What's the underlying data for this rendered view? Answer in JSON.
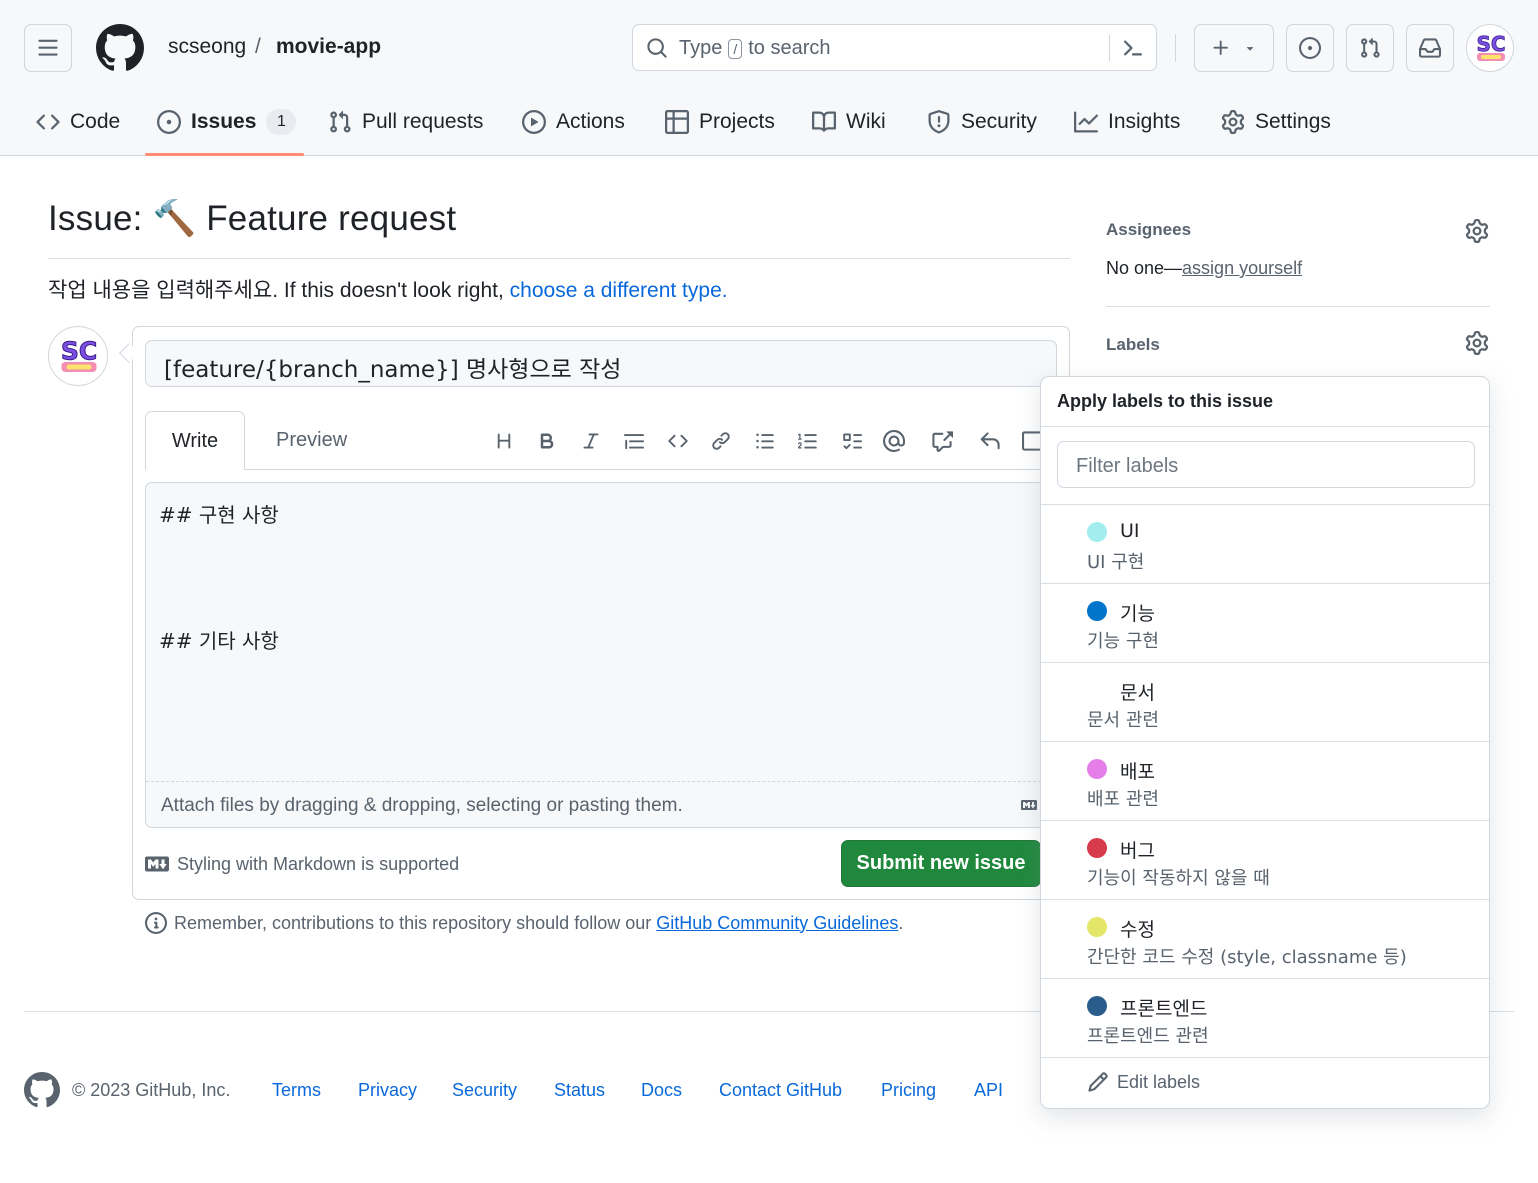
{
  "header": {
    "owner": "scseong",
    "separator": "/",
    "repo": "movie-app",
    "search": {
      "prefix": "Type",
      "key": "/",
      "suffix": "to search"
    },
    "avatar_text": "SC"
  },
  "tabs": [
    {
      "label": "Code",
      "icon": "code-icon"
    },
    {
      "label": "Issues",
      "icon": "issue-opened-icon",
      "counter": "1"
    },
    {
      "label": "Pull requests",
      "icon": "git-pull-request-icon"
    },
    {
      "label": "Actions",
      "icon": "play-icon"
    },
    {
      "label": "Projects",
      "icon": "table-icon"
    },
    {
      "label": "Wiki",
      "icon": "book-icon"
    },
    {
      "label": "Security",
      "icon": "shield-icon"
    },
    {
      "label": "Insights",
      "icon": "graph-icon"
    },
    {
      "label": "Settings",
      "icon": "gear-icon"
    }
  ],
  "page": {
    "title": "Issue: 🔨 Feature request",
    "subtitle_prefix": "작업 내용을 입력해주세요. If this doesn't look right, ",
    "subtitle_link": "choose a different type."
  },
  "form": {
    "title_value": "[feature/{branch_name}] 명사형으로 작성",
    "tab_write": "Write",
    "tab_preview": "Preview",
    "body_line_1": "## 구현 사항",
    "body_line_2": "## 기타 사항",
    "attach_text": "Attach files by dragging & dropping, selecting or pasting them.",
    "markdown_note": "Styling with Markdown is supported",
    "submit_label": "Submit new issue"
  },
  "remember": {
    "prefix": "Remember, contributions to this repository should follow our ",
    "link": "GitHub Community Guidelines",
    "suffix": "."
  },
  "sidebar": {
    "assignees_heading": "Assignees",
    "assignees_none": "No one—",
    "assign_yourself": "assign yourself",
    "labels_heading": "Labels"
  },
  "labels_dropdown": {
    "title": "Apply labels to this issue",
    "filter_placeholder": "Filter labels",
    "items": [
      {
        "name": "UI",
        "description": "UI 구현",
        "color": "#a2eeef"
      },
      {
        "name": "기능",
        "description": "기능 구현",
        "color": "#0075ca"
      },
      {
        "name": "문서",
        "description": "문서 관련",
        "color": "#ffffff"
      },
      {
        "name": "배포",
        "description": "배포 관련",
        "color": "#e57ee8"
      },
      {
        "name": "버그",
        "description": "기능이 작동하지 않을 때",
        "color": "#d73a4a"
      },
      {
        "name": "수정",
        "description": "간단한 코드 수정 (style, classname 등)",
        "color": "#e4e669"
      },
      {
        "name": "프론트엔드",
        "description": "프론트엔드 관련",
        "color": "#2b5d8c"
      }
    ],
    "edit_labels": "Edit labels"
  },
  "footer": {
    "copyright": "© 2023 GitHub, Inc.",
    "links": [
      "Terms",
      "Privacy",
      "Security",
      "Status",
      "Docs",
      "Contact GitHub",
      "Pricing",
      "API"
    ]
  }
}
